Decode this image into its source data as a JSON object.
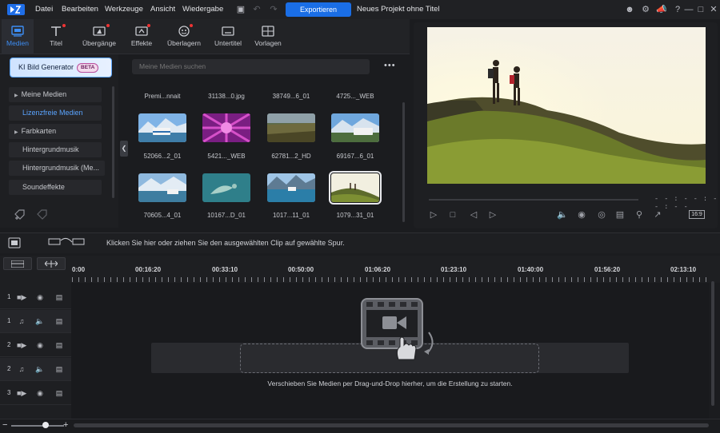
{
  "menu": {
    "items": [
      "Datei",
      "Bearbeiten",
      "Werkzeuge",
      "Ansicht",
      "Wiedergabe"
    ],
    "export_label": "Exportieren",
    "project_title": "Neues Projekt ohne Titel"
  },
  "tabs": [
    {
      "label": "Medien",
      "icon": "media-icon",
      "active": true
    },
    {
      "label": "Titel",
      "icon": "title-icon",
      "dot": true
    },
    {
      "label": "Übergänge",
      "icon": "transitions-icon",
      "dot": true
    },
    {
      "label": "Effekte",
      "icon": "effects-icon",
      "dot": true
    },
    {
      "label": "Überlagern",
      "icon": "overlay-icon",
      "dot": true
    },
    {
      "label": "Untertitel",
      "icon": "subtitles-icon"
    },
    {
      "label": "Vorlagen",
      "icon": "templates-icon"
    }
  ],
  "sidebar": {
    "ai_button": "KI Bild Generator",
    "ai_badge": "BETA",
    "categories": [
      {
        "label": "Meine Medien",
        "expandable": true
      },
      {
        "label": "Lizenzfreie Medien",
        "selected": true
      },
      {
        "label": "Farbkarten",
        "expandable": true
      },
      {
        "label": "Hintergrundmusik"
      },
      {
        "label": "Hintergrundmusik (Me..."
      },
      {
        "label": "Soundeffekte"
      }
    ]
  },
  "media": {
    "search_placeholder": "Meine Medien suchen",
    "top_row_labels": [
      "Premi...nnait",
      "31138...0.jpg",
      "38749...6_01",
      "4725..._WEB"
    ],
    "items": [
      {
        "label": "52066...2_01",
        "thumb": "camper-mountains"
      },
      {
        "label": "5421..._WEB",
        "thumb": "pink-sunburst"
      },
      {
        "label": "62781...2_HD",
        "thumb": "grass-landscape"
      },
      {
        "label": "69167...6_01",
        "thumb": "camper-road"
      },
      {
        "label": "70605...4_01",
        "thumb": "lake-camper"
      },
      {
        "label": "10167...D_01",
        "thumb": "turtle-underwater"
      },
      {
        "label": "1017...11_01",
        "thumb": "lake-mountains"
      },
      {
        "label": "1079...31_01",
        "thumb": "hikers-hill",
        "selected": true
      }
    ]
  },
  "preview": {
    "timecode": "- - : - - : - - : - -",
    "aspect": "16:9"
  },
  "timeline": {
    "hint": "Klicken Sie hier oder ziehen Sie den ausgewählten Clip auf gewählte Spur.",
    "ruler": [
      "0:00",
      "00:16:20",
      "00:33:10",
      "00:50:00",
      "01:06:20",
      "01:23:10",
      "01:40:00",
      "01:56:20",
      "02:13:10"
    ],
    "tracks": [
      {
        "num": "1",
        "type": "video"
      },
      {
        "num": "1",
        "type": "audio"
      },
      {
        "num": "2",
        "type": "video"
      },
      {
        "num": "2",
        "type": "audio"
      },
      {
        "num": "3",
        "type": "video"
      }
    ],
    "drop_text": "Verschieben Sie Medien per Drag-und-Drop hierher, um die Erstellung zu starten."
  },
  "colors": {
    "accent": "#1a6ee6",
    "selected_text": "#5aa4ff"
  }
}
